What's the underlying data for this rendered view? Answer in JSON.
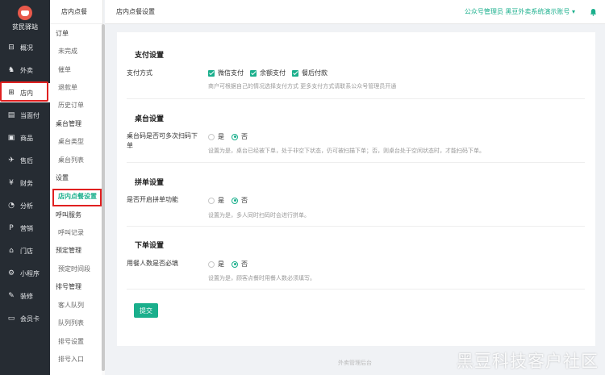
{
  "sidebar": {
    "brand_name": "贫民驿站",
    "items": [
      {
        "label": "概况",
        "icon": "overview-icon",
        "glyph": "⊟"
      },
      {
        "label": "外卖",
        "icon": "bike-icon",
        "glyph": "♞"
      },
      {
        "label": "店内",
        "icon": "store-icon",
        "glyph": "⊞"
      },
      {
        "label": "当面付",
        "icon": "pay-icon",
        "glyph": "▤"
      },
      {
        "label": "商品",
        "icon": "goods-icon",
        "glyph": "▣"
      },
      {
        "label": "售后",
        "icon": "aftersale-icon",
        "glyph": "✈"
      },
      {
        "label": "财务",
        "icon": "finance-icon",
        "glyph": "¥"
      },
      {
        "label": "分析",
        "icon": "analysis-icon",
        "glyph": "◔"
      },
      {
        "label": "营销",
        "icon": "marketing-icon",
        "glyph": "P"
      },
      {
        "label": "门店",
        "icon": "shop-icon",
        "glyph": "⌂"
      },
      {
        "label": "小程序",
        "icon": "miniapp-icon",
        "glyph": "⚙"
      },
      {
        "label": "装修",
        "icon": "decorate-icon",
        "glyph": "✎"
      },
      {
        "label": "会员卡",
        "icon": "member-card-icon",
        "glyph": "▭"
      }
    ]
  },
  "submenu": {
    "title": "店内点餐",
    "items": [
      {
        "label": "订单",
        "kind": "group"
      },
      {
        "label": "未完成",
        "kind": "child"
      },
      {
        "label": "催单",
        "kind": "child"
      },
      {
        "label": "退款单",
        "kind": "child"
      },
      {
        "label": "历史订单",
        "kind": "child"
      },
      {
        "label": "桌台管理",
        "kind": "group"
      },
      {
        "label": "桌台类型",
        "kind": "child"
      },
      {
        "label": "桌台列表",
        "kind": "child"
      },
      {
        "label": "设置",
        "kind": "group"
      },
      {
        "label": "店内点餐设置",
        "kind": "active"
      },
      {
        "label": "呼叫服务",
        "kind": "group"
      },
      {
        "label": "呼叫记录",
        "kind": "child"
      },
      {
        "label": "预定管理",
        "kind": "group"
      },
      {
        "label": "预定时间段",
        "kind": "child"
      },
      {
        "label": "排号管理",
        "kind": "group"
      },
      {
        "label": "客人队列",
        "kind": "child"
      },
      {
        "label": "队列列表",
        "kind": "child"
      },
      {
        "label": "排号设置",
        "kind": "child"
      },
      {
        "label": "排号入口",
        "kind": "child"
      }
    ]
  },
  "header": {
    "title": "店内点餐设置",
    "account": "公众号管理员 黑豆外卖系统演示账号 ▾"
  },
  "sections": {
    "payment": {
      "title": "支付设置",
      "label": "支付方式",
      "options": [
        "微信支付",
        "余额支付",
        "餐后付款"
      ],
      "help": "商户可根据自己的情况选择支付方式 更多支付方式请联系公众号管理员开通"
    },
    "table": {
      "title": "桌台设置",
      "label": "桌台码是否可多次扫码下单",
      "yes": "是",
      "no": "否",
      "help": "设置为是，桌台已经被下单，处于非空下状态，仍可被扫描下单；否，则桌台处于空闲状态时，才能扫码下单。"
    },
    "group_order": {
      "title": "拼单设置",
      "label": "是否开启拼单功能",
      "yes": "是",
      "no": "否",
      "help": "设置为是，多人同时扫码时会进行拼单。"
    },
    "order": {
      "title": "下单设置",
      "label": "用餐人数是否必填",
      "yes": "是",
      "no": "否",
      "help": "设置为是，顾客点餐时用餐人数必须填写。"
    }
  },
  "submit_label": "提交",
  "footer": "外卖管理后台",
  "watermark": "黑豆科技客户社区",
  "colors": {
    "accent": "#1aaf8c",
    "sidebar": "#262c33",
    "highlight": "#e02020"
  }
}
